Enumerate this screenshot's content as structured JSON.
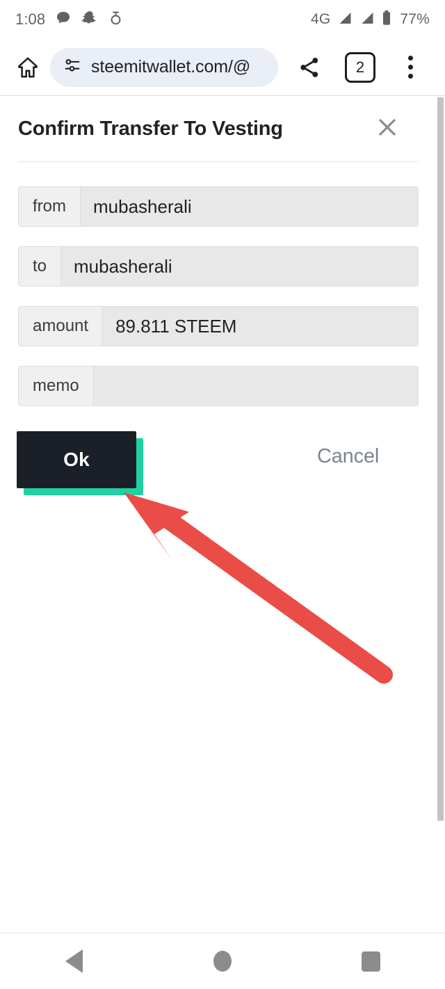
{
  "status_bar": {
    "time": "1:08",
    "icons": [
      "message-bubble-icon",
      "snapchat-ghost-icon",
      "ring-alarm-icon"
    ],
    "network": "4G",
    "battery_percent": "77%"
  },
  "browser": {
    "home_icon": "home-icon",
    "site_settings_icon": "site-settings-tune-icon",
    "url": "steemitwallet.com/@",
    "share_icon": "share-icon",
    "tab_count": "2",
    "menu_icon": "three-dot-menu-icon"
  },
  "dialog": {
    "title": "Confirm Transfer To Vesting",
    "close_icon": "close-x-icon",
    "fields": [
      {
        "label": "from",
        "value": "mubasherali"
      },
      {
        "label": "to",
        "value": "mubasherali"
      },
      {
        "label": "amount",
        "value": "89.811 STEEM"
      },
      {
        "label": "memo",
        "value": ""
      }
    ],
    "ok_label": "Ok",
    "cancel_label": "Cancel"
  },
  "colors": {
    "accent_teal": "#1fd1a0",
    "button_dark": "#1b2028",
    "annotation_red": "#ea4c47",
    "url_pill": "#e9eef7",
    "field_label_bg": "#f0f0f0",
    "field_value_bg": "#e8e8e8"
  },
  "annotation": {
    "type": "arrow",
    "points_to": "ok-button",
    "color": "#ea4c47"
  },
  "navbar": {
    "back": "back-triangle-icon",
    "home": "home-circle-icon",
    "recents": "recents-square-icon"
  }
}
